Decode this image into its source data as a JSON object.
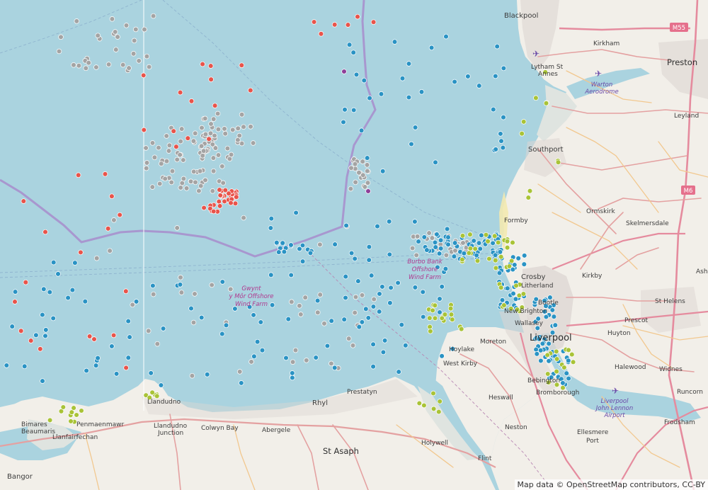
{
  "attribution": "Map data © OpenStreetMap contributors, CC-BY",
  "colors": {
    "sea": "#aad3df",
    "land": "#f2efe9",
    "beach": "#f3e9b0",
    "mudflat": "#dfe4e0",
    "boundary": "#a897cf",
    "urban": "#dcd6d2",
    "primary_road": "#e4a1a1",
    "secondary_road": "#f2c88f",
    "motorway": "#e58b9e",
    "marker_blue": "#2a93c4",
    "marker_grey": "#a4a4a4",
    "marker_red": "#e8544b",
    "marker_green": "#a9c337",
    "marker_purple": "#8e3f99"
  },
  "places": [
    {
      "id": "blackpool",
      "name": "Blackpool"
    },
    {
      "id": "kirkham",
      "name": "Kirkham"
    },
    {
      "id": "preston",
      "name": "Preston"
    },
    {
      "id": "lytham",
      "name": "Lytham St"
    },
    {
      "id": "lytham2",
      "name": "Annes"
    },
    {
      "id": "leyland",
      "name": "Leyland"
    },
    {
      "id": "southport",
      "name": "Southport"
    },
    {
      "id": "ormskirk",
      "name": "Ormskirk"
    },
    {
      "id": "skelmersdale",
      "name": "Skelmersdale"
    },
    {
      "id": "formby",
      "name": "Formby"
    },
    {
      "id": "crosby",
      "name": "Crosby"
    },
    {
      "id": "litherland",
      "name": "Litherland"
    },
    {
      "id": "kirkby",
      "name": "Kirkby"
    },
    {
      "id": "ash",
      "name": "Ash"
    },
    {
      "id": "bootle",
      "name": "Bootle"
    },
    {
      "id": "sthelens",
      "name": "St Helens"
    },
    {
      "id": "newbrighton",
      "name": "New Brighton"
    },
    {
      "id": "wallasey",
      "name": "Wallasey"
    },
    {
      "id": "prescot",
      "name": "Prescot"
    },
    {
      "id": "liverpool",
      "name": "Liverpool"
    },
    {
      "id": "huyton",
      "name": "Huyton"
    },
    {
      "id": "moreton",
      "name": "Moreton"
    },
    {
      "id": "hoylake",
      "name": "Hoylake"
    },
    {
      "id": "westkirby",
      "name": "West Kirby"
    },
    {
      "id": "halewood",
      "name": "Halewood"
    },
    {
      "id": "widnes",
      "name": "Widnes"
    },
    {
      "id": "bebington",
      "name": "Bebington"
    },
    {
      "id": "bromborough",
      "name": "Bromborough"
    },
    {
      "id": "heswall",
      "name": "Heswall"
    },
    {
      "id": "runcorn",
      "name": "Runcorn"
    },
    {
      "id": "neston",
      "name": "Neston"
    },
    {
      "id": "ellesmereport",
      "name": "Ellesmere"
    },
    {
      "id": "ellesmereport2",
      "name": "Port"
    },
    {
      "id": "frodsham",
      "name": "Frodsham"
    },
    {
      "id": "prestatyn",
      "name": "Prestatyn"
    },
    {
      "id": "rhyl",
      "name": "Rhyl"
    },
    {
      "id": "llandudno",
      "name": "Llandudno"
    },
    {
      "id": "llandudnojn",
      "name": "Llandudno"
    },
    {
      "id": "llandudnojn2",
      "name": "Junction"
    },
    {
      "id": "colwynbay",
      "name": "Colwyn Bay"
    },
    {
      "id": "abergele",
      "name": "Abergele"
    },
    {
      "id": "stasaph",
      "name": "St Asaph"
    },
    {
      "id": "holywell",
      "name": "Holywell"
    },
    {
      "id": "flint",
      "name": "Flint"
    },
    {
      "id": "bangor",
      "name": "Bangor"
    },
    {
      "id": "bimwares",
      "name": "Bimares"
    },
    {
      "id": "beaumaris",
      "name": "Beaumaris"
    },
    {
      "id": "penmaenmawr",
      "name": "Penmaenmawr"
    },
    {
      "id": "llanfairfechan",
      "name": "Llanfairfechan"
    }
  ],
  "wind_farms": [
    {
      "id": "gwynt",
      "lines": [
        "Gwynt",
        "y Môr Offshore",
        "Wind Farm"
      ]
    },
    {
      "id": "burbo",
      "lines": [
        "Burbo Bank",
        "Offshore",
        "Wind Farm"
      ]
    }
  ],
  "airports": [
    {
      "id": "warton",
      "lines": [
        "Warton",
        "Aerodrome"
      ]
    },
    {
      "id": "jla",
      "lines": [
        "Liverpool",
        "John Lennon",
        "Airport"
      ]
    }
  ],
  "road_shields": [
    {
      "id": "m55",
      "label": "M55"
    },
    {
      "id": "m6",
      "label": "M6"
    }
  ]
}
